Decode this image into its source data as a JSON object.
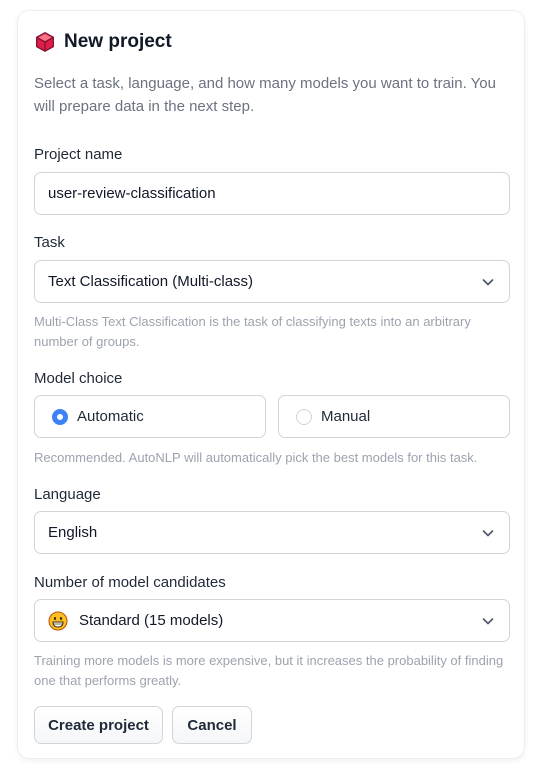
{
  "header": {
    "title": "New project",
    "icon": "cube-icon",
    "icon_color": "#e11d48"
  },
  "intro": {
    "text": "Select a task, language, and how many models you want to train. You will prepare data in the next step."
  },
  "project_name": {
    "label": "Project name",
    "value": "user-review-classification"
  },
  "task": {
    "label": "Task",
    "selected": "Text Classification (Multi-class)",
    "hint": "Multi-Class Text Classification is the task of classifying texts into an arbitrary number of groups."
  },
  "model_choice": {
    "label": "Model choice",
    "options": [
      {
        "label": "Automatic",
        "selected": true
      },
      {
        "label": "Manual",
        "selected": false
      }
    ],
    "hint": "Recommended. AutoNLP will automatically pick the best models for this task."
  },
  "language": {
    "label": "Language",
    "selected": "English"
  },
  "candidates": {
    "label": "Number of model candidates",
    "selected": "Standard (15 models)",
    "icon": "grinning-face-icon",
    "hint": "Training more models is more expensive, but it increases the probability of finding one that performs greatly."
  },
  "actions": {
    "create_label": "Create project",
    "cancel_label": "Cancel"
  },
  "colors": {
    "accent": "#3b82f6",
    "hint_text": "#9ca3af",
    "border": "#d1d5db"
  }
}
